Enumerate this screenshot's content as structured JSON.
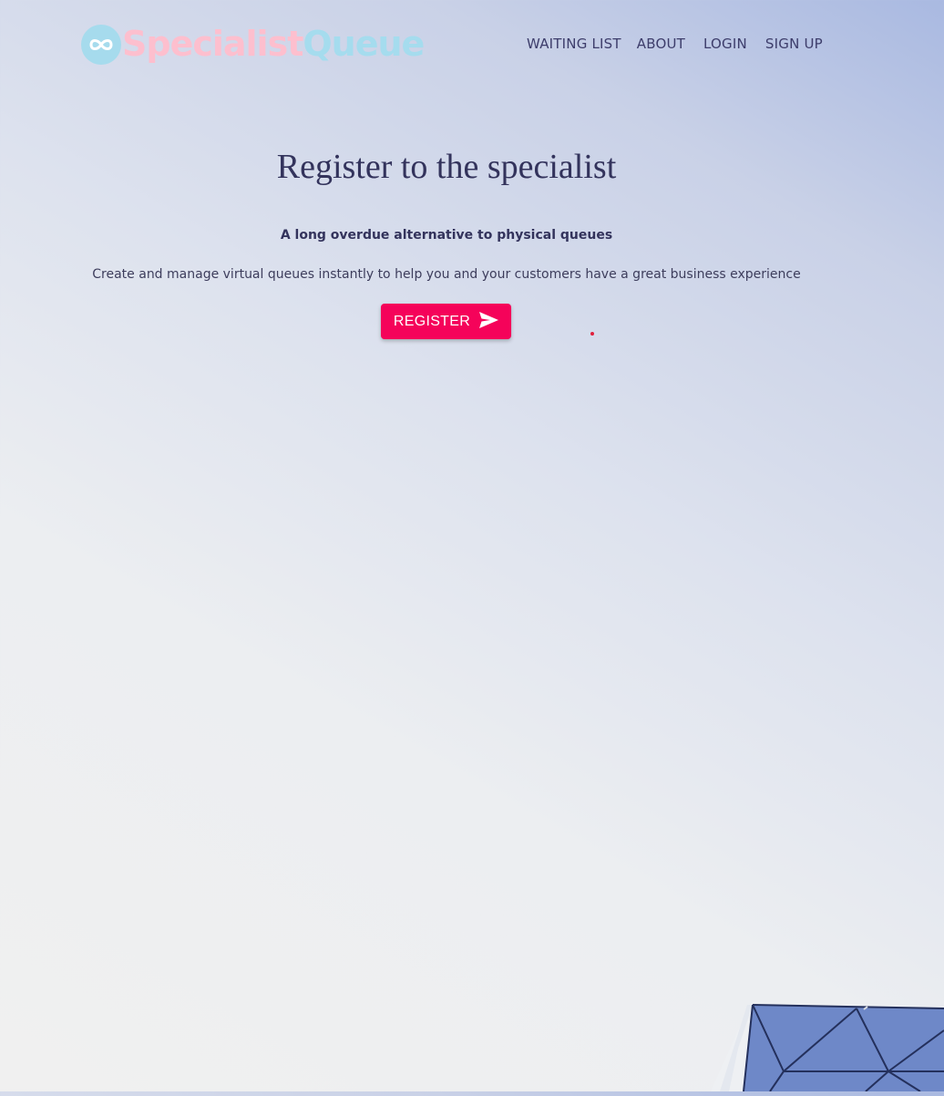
{
  "brand": {
    "name_part1": "Specialist",
    "name_part2": "Queue",
    "icon": "infinity-icon",
    "colors": {
      "pink": "#fdbfce",
      "cyan": "#a5dcee"
    }
  },
  "nav": {
    "items": [
      {
        "label": "WAITING LIST"
      },
      {
        "label": "ABOUT"
      },
      {
        "label": "LOGIN"
      },
      {
        "label": "SIGN UP"
      }
    ]
  },
  "hero": {
    "title": "Register to the specialist",
    "subtitle": "A long overdue alternative to physical queues",
    "description": "Create and manage virtual queues instantly to help you and your customers have a great business experience",
    "button": {
      "label": "REGISTER",
      "icon": "send-icon",
      "color": "#f5035a"
    }
  },
  "colors": {
    "text": "#33335c",
    "accent": "#f5035a"
  }
}
